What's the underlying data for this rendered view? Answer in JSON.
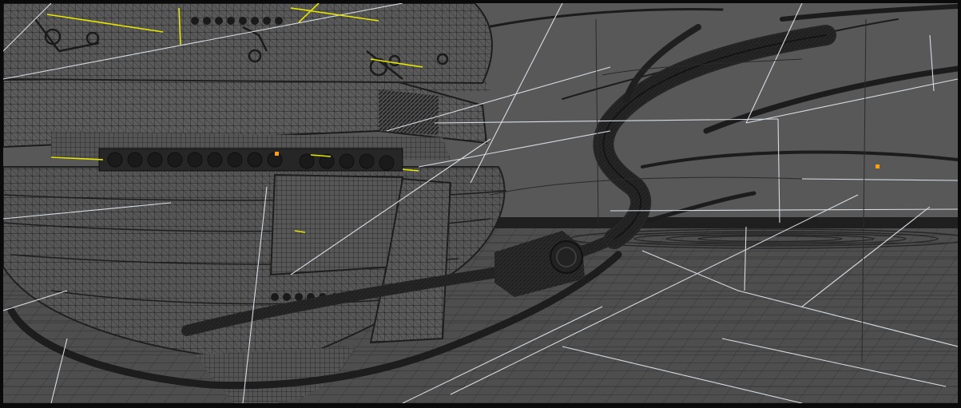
{
  "viewport": {
    "colors": {
      "background": "#585858",
      "wireframe": "#222222",
      "guide_lines": "#d8dde3",
      "selection": "#e6e600",
      "vertex_marker": "#ff9f0a",
      "frame": "#0a0a0a"
    }
  }
}
